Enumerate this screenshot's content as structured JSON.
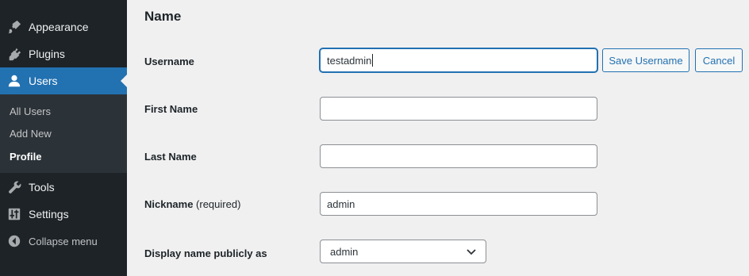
{
  "sidebar": {
    "menu": [
      {
        "label": "Appearance",
        "icon": "paintbrush-icon"
      },
      {
        "label": "Plugins",
        "icon": "plugin-icon"
      },
      {
        "label": "Users",
        "icon": "user-icon",
        "active": true
      },
      {
        "label": "Tools",
        "icon": "wrench-icon"
      },
      {
        "label": "Settings",
        "icon": "settings-icon"
      }
    ],
    "submenu": [
      {
        "label": "All Users"
      },
      {
        "label": "Add New"
      },
      {
        "label": "Profile",
        "current": true
      }
    ],
    "collapse_label": "Collapse menu",
    "active_color": "#2271b1"
  },
  "main": {
    "section_title": "Name",
    "fields": {
      "username": {
        "label": "Username",
        "value": "testadmin"
      },
      "first_name": {
        "label": "First Name",
        "value": ""
      },
      "last_name": {
        "label": "Last Name",
        "value": ""
      },
      "nickname": {
        "label": "Nickname",
        "required_note": "(required)",
        "value": "admin"
      },
      "display_name": {
        "label": "Display name publicly as",
        "selected": "admin"
      }
    },
    "buttons": {
      "save_username": "Save Username",
      "cancel": "Cancel"
    }
  }
}
